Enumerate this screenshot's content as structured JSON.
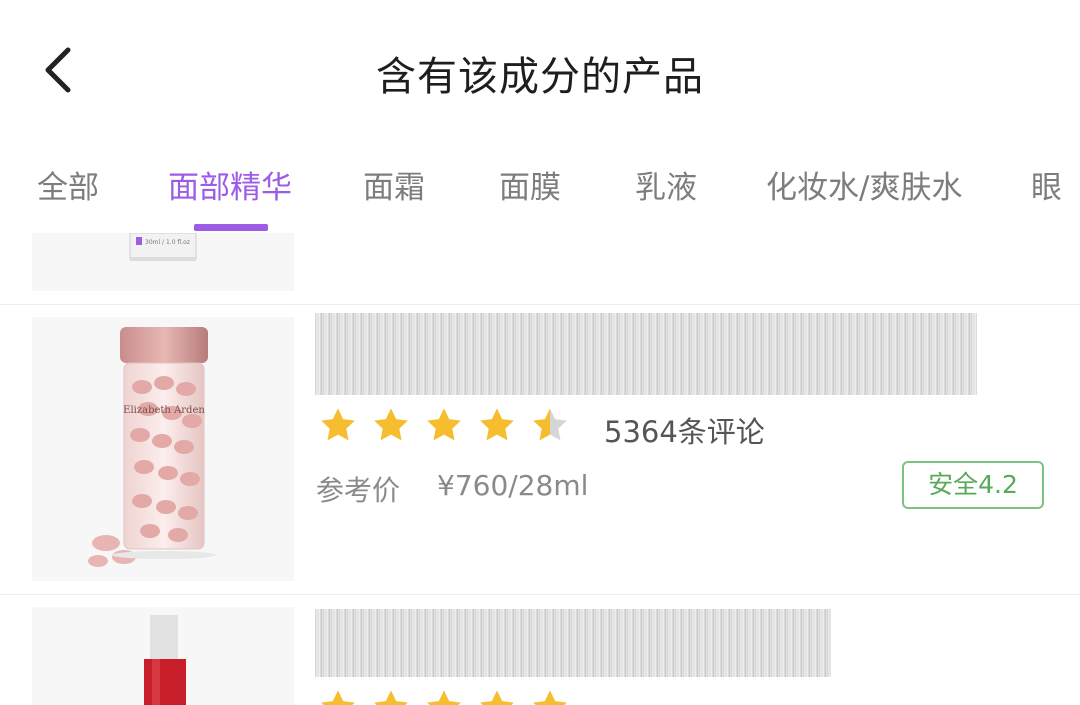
{
  "header": {
    "title": "含有该成分的产品"
  },
  "tabs": [
    {
      "label": "全部",
      "active": false
    },
    {
      "label": "面部精华",
      "active": true
    },
    {
      "label": "面霜",
      "active": false
    },
    {
      "label": "面膜",
      "active": false
    },
    {
      "label": "乳液",
      "active": false
    },
    {
      "label": "化妆水/爽肤水",
      "active": false
    },
    {
      "label": "眼",
      "active": false
    }
  ],
  "products": [
    {
      "image": "partially-visible-jar-product-image",
      "label_text": "30ml / 1.0 fl.oz"
    },
    {
      "image": "elizabeth-arden-ceramide-capsules-bottle",
      "brand_text": "Elizabeth Arden",
      "rating": 4.5,
      "review_count": "5364条评论",
      "price_label": "参考价",
      "price": "¥760/28ml",
      "safety": "安全4.2"
    },
    {
      "image": "red-serum-bottle",
      "rating": 5
    }
  ],
  "colors": {
    "accent": "#9c5ce6",
    "star": "#f6bd2f",
    "star_empty": "#d6d6d6",
    "safety": "#58a958"
  }
}
